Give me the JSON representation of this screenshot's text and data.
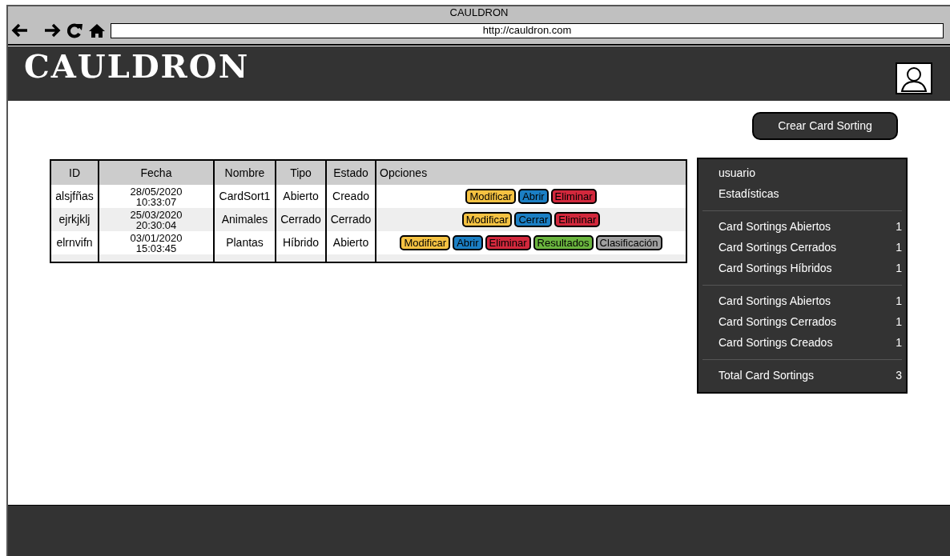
{
  "browser": {
    "title": "CAULDRON",
    "url": "http://cauldron.com"
  },
  "header": {
    "logo": "CAULDRON"
  },
  "create_button": "Crear Card Sorting",
  "table": {
    "columns": [
      "ID",
      "Fecha",
      "Nombre",
      "Tipo",
      "Estado",
      "Opciones"
    ],
    "rows": [
      {
        "id": "alsjfñas",
        "date": "28/05/2020",
        "time": "10:33:07",
        "name": "CardSort1",
        "type": "Abierto",
        "state": "Creado",
        "options": [
          {
            "label": "Modificar",
            "color": "#f5c242"
          },
          {
            "label": "Abrir",
            "color": "#1b7fc4"
          },
          {
            "label": "Eliminar",
            "color": "#d2283c"
          }
        ]
      },
      {
        "id": "ejrkjklj",
        "date": "25/03/2020",
        "time": "20:30:04",
        "name": "Animales",
        "type": "Cerrado",
        "state": "Cerrado",
        "options": [
          {
            "label": "Modificar",
            "color": "#f5c242"
          },
          {
            "label": "Cerrar",
            "color": "#1b7fc4"
          },
          {
            "label": "Eliminar",
            "color": "#d2283c"
          }
        ]
      },
      {
        "id": "elrnvifn",
        "date": "03/01/2020",
        "time": "15:03:45",
        "name": "Plantas",
        "type": "Híbrido",
        "state": "Abierto",
        "options": [
          {
            "label": "Modificar",
            "color": "#f5c242"
          },
          {
            "label": "Abrir",
            "color": "#1b7fc4"
          },
          {
            "label": "Eliminar",
            "color": "#d2283c"
          },
          {
            "label": "Resultados",
            "color": "#6ab43e"
          },
          {
            "label": "Clasificación",
            "color": "#a0a0a0"
          }
        ]
      }
    ]
  },
  "sidebar": {
    "user": "usuario",
    "title": "Estadísticas",
    "groups": [
      [
        {
          "label": "Card Sortings Abiertos",
          "value": "1"
        },
        {
          "label": "Card Sortings Cerrados",
          "value": "1"
        },
        {
          "label": "Card Sortings Híbridos",
          "value": "1"
        }
      ],
      [
        {
          "label": "Card Sortings Abiertos",
          "value": "1"
        },
        {
          "label": "Card Sortings Cerrados",
          "value": "1"
        },
        {
          "label": "Card Sortings Creados",
          "value": "1"
        }
      ],
      [
        {
          "label": "Total Card Sortings",
          "value": "3"
        }
      ]
    ]
  }
}
